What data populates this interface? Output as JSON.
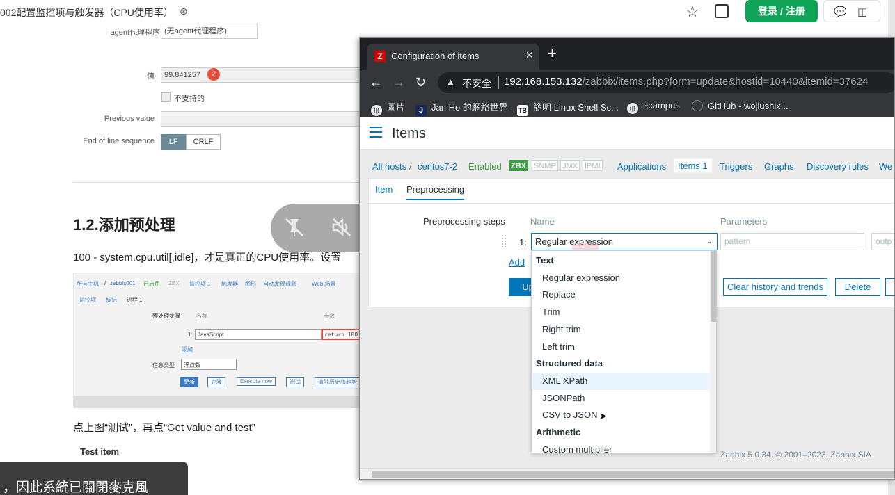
{
  "doc": {
    "title": "002配置监控项与触发器（CPU使用率）",
    "login_button": "登录 / 注册",
    "icons": {
      "title": "pin-icon",
      "star": "star-icon",
      "comment": "comment-icon",
      "layout": "layout-icon"
    },
    "form": {
      "agent_select": "(无agent代理程序)",
      "agent_label": "agent代理程序",
      "value_label": "值",
      "value": "99.841257",
      "value_badge": "2",
      "unsupported_label": "不支持的",
      "previous_value_label": "Previous value",
      "eol_label": "End of line sequence",
      "eol_options": [
        "LF",
        "CRLF"
      ],
      "eol_selected": "LF"
    },
    "heading": "1.2.添加预处理",
    "paragraph": "100 - system.cpu.util[,idle]，才是真正的CPU使用率。设置",
    "embedded_screenshot": {
      "breadcrumb": [
        "所有主机",
        "/",
        "zabbix001",
        "已启用",
        "ZBX",
        "监控项 1",
        "触发器",
        "图形",
        "自动发现规则",
        "Web 场景"
      ],
      "tabs": [
        "监控项",
        "标记",
        "进程 1"
      ],
      "step_label": "预处理步骤",
      "name_header": "名称",
      "param_header": "参数",
      "step_index": "1:",
      "step_value": "JavaScript",
      "param_value": "return 100",
      "add_link": "添加",
      "info_type_label": "信息类型",
      "info_type_value": "浮点数",
      "buttons": [
        "更新",
        "克隆",
        "Execute now",
        "测试",
        "清除历史和趋势"
      ]
    },
    "instruction": "点上图“测试”，再点“Get value and test”",
    "test_item": "Test item",
    "toast": "，因此系統已關閉麥克風"
  },
  "media_pill": {
    "icons": [
      "mic-off-icon",
      "speaker-off-icon",
      "minus-circle-icon"
    ]
  },
  "browser": {
    "tab_title": "Configuration of items",
    "tab_favicon": "Z",
    "new_tab": "+",
    "insecure": "不安全",
    "url_host": "192.168.153.132",
    "url_path": "/zabbix/items.php?form=update&hostid=10440&itemid=37624",
    "bookmarks": [
      {
        "label": "圖片",
        "icon": "globe-icon"
      },
      {
        "label": "Jan Ho 的網絡世界",
        "icon": "J"
      },
      {
        "label": "簡明 Linux Shell Sc...",
        "icon": "TB"
      },
      {
        "label": "ecampus",
        "icon": "globe-icon"
      },
      {
        "label": "GitHub - wojiushix...",
        "icon": "github-icon"
      }
    ]
  },
  "zabbix": {
    "page_title": "Items",
    "breadcrumb": {
      "all_hosts": "All hosts",
      "sep": "/",
      "host": "centos7-2",
      "status": "Enabled",
      "tags": [
        "ZBX",
        "SNMP",
        "JMX",
        "IPMI"
      ],
      "links": [
        "Applications",
        "Items 1",
        "Triggers",
        "Graphs",
        "Discovery rules",
        "We"
      ]
    },
    "subtabs": [
      "Item",
      "Preprocessing"
    ],
    "active_subtab": "Preprocessing",
    "preprocessing_label": "Preprocessing steps",
    "name_header": "Name",
    "params_header": "Parameters",
    "step_index": "1:",
    "step_selected": "Regular expression",
    "param_placeholder": "pattern",
    "param2_placeholder": "outp",
    "add_link": "Add",
    "update_button": "Up",
    "clear_button": "Clear history and trends",
    "delete_button": "Delete",
    "footer": "Zabbix 5.0.34. © 2001–2023, Zabbix SIA",
    "dropdown": [
      {
        "label": "Text",
        "group": true
      },
      {
        "label": "Regular expression"
      },
      {
        "label": "Replace"
      },
      {
        "label": "Trim"
      },
      {
        "label": "Right trim"
      },
      {
        "label": "Left trim"
      },
      {
        "label": "Structured data",
        "group": true
      },
      {
        "label": "XML XPath",
        "hover": true
      },
      {
        "label": "JSONPath"
      },
      {
        "label": "CSV to JSON"
      },
      {
        "label": "Arithmetic",
        "group": true
      },
      {
        "label": "Custom multiplier"
      }
    ]
  }
}
